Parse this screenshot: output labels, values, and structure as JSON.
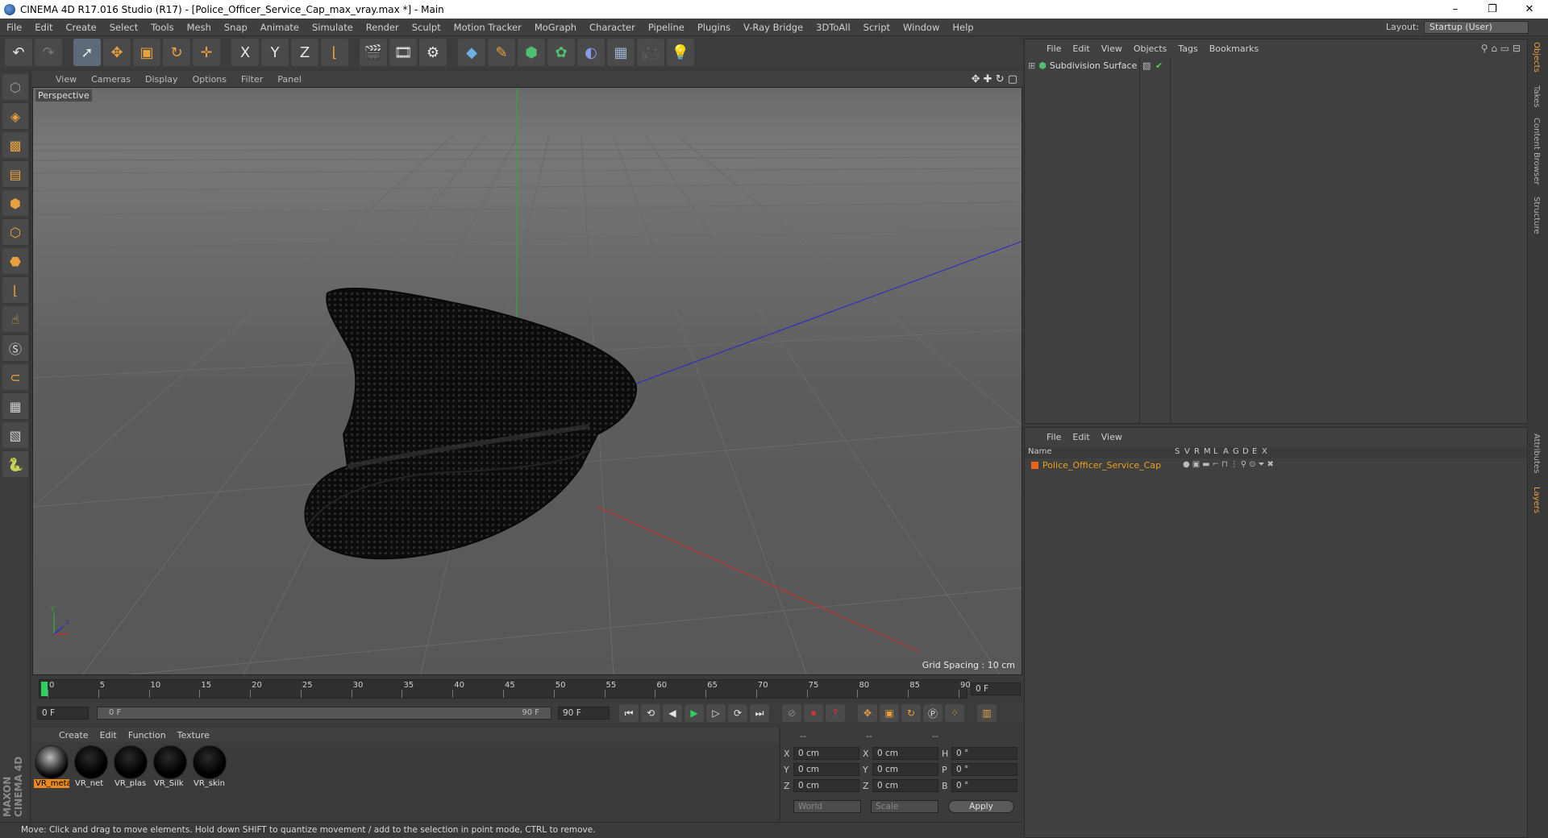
{
  "window": {
    "title": "CINEMA 4D R17.016 Studio (R17) - [Police_Officer_Service_Cap_max_vray.max *] - Main",
    "controls": [
      "–",
      "❐",
      "✕"
    ]
  },
  "menubar": {
    "items": [
      "File",
      "Edit",
      "Create",
      "Select",
      "Tools",
      "Mesh",
      "Snap",
      "Animate",
      "Simulate",
      "Render",
      "Sculpt",
      "Motion Tracker",
      "MoGraph",
      "Character",
      "Pipeline",
      "Plugins",
      "V-Ray Bridge",
      "3DToAll",
      "Script",
      "Window",
      "Help"
    ],
    "layout_label": "Layout:",
    "layout_value": "Startup (User)"
  },
  "toolbar": {
    "icons": [
      "undo-icon",
      "redo-icon",
      "select-icon",
      "move-icon",
      "scale-icon",
      "rotate-icon",
      "live-selection-icon",
      "x-axis-icon",
      "y-axis-icon",
      "z-axis-icon",
      "coordinate-system-icon",
      "render-view-icon",
      "render-picture-viewer-icon",
      "edit-render-settings-icon",
      "cube-icon",
      "pen-icon",
      "subdivision-icon",
      "array-icon",
      "deformer-icon",
      "floor-icon",
      "camera-icon",
      "light-icon"
    ],
    "axis_labels": [
      "X",
      "Y",
      "Z"
    ]
  },
  "viewport": {
    "menu": [
      "View",
      "Cameras",
      "Display",
      "Options",
      "Filter",
      "Panel"
    ],
    "label": "Perspective",
    "grid_info": "Grid Spacing : 10 cm"
  },
  "timeline": {
    "ticks": [
      "0",
      "5",
      "10",
      "15",
      "20",
      "25",
      "30",
      "35",
      "40",
      "45",
      "50",
      "55",
      "60",
      "65",
      "70",
      "75",
      "80",
      "85",
      "90"
    ],
    "current_frame": "0 F",
    "start_field": "0 F",
    "range_start": "0 F",
    "range_end": "90 F",
    "end_field": "90 F"
  },
  "materials": {
    "menu": [
      "Create",
      "Edit",
      "Function",
      "Texture"
    ],
    "items": [
      "VR_meta",
      "VR_net",
      "VR_plas",
      "VR_Silk",
      "VR_skin"
    ],
    "selected_index": 0
  },
  "coordinates": {
    "header": [
      "--",
      "--",
      "--"
    ],
    "rows": [
      {
        "axis": "X",
        "pos": "0 cm",
        "size_axis": "X",
        "size": "0 cm",
        "rot_axis": "H",
        "rot": "0 °"
      },
      {
        "axis": "Y",
        "pos": "0 cm",
        "size_axis": "Y",
        "size": "0 cm",
        "rot_axis": "P",
        "rot": "0 °"
      },
      {
        "axis": "Z",
        "pos": "0 cm",
        "size_axis": "Z",
        "size": "0 cm",
        "rot_axis": "B",
        "rot": "0 °"
      }
    ],
    "mode": "World",
    "scale": "Scale",
    "apply": "Apply"
  },
  "objects": {
    "menu": [
      "File",
      "Edit",
      "View",
      "Objects",
      "Tags",
      "Bookmarks"
    ],
    "items": [
      {
        "name": "Subdivision Surface"
      }
    ]
  },
  "layers": {
    "menu": [
      "File",
      "Edit",
      "View"
    ],
    "columns": [
      "Name",
      "S",
      "V",
      "R",
      "M",
      "L",
      "A",
      "G",
      "D",
      "E",
      "X"
    ],
    "rows": [
      {
        "name": "Police_Officer_Service_Cap",
        "color": "#e8641e"
      }
    ]
  },
  "side_tabs": [
    "Objects",
    "Takes",
    "Content Browser",
    "Structure",
    "Attributes",
    "Layers"
  ],
  "status": "Move: Click and drag to move elements. Hold down SHIFT to quantize movement / add to the selection in point mode, CTRL to remove.",
  "brand": "MAXON CINEMA 4D",
  "colors": {
    "accent": "#e8a040",
    "selection": "#e88a20",
    "layer_swatch": "#e8641e"
  }
}
